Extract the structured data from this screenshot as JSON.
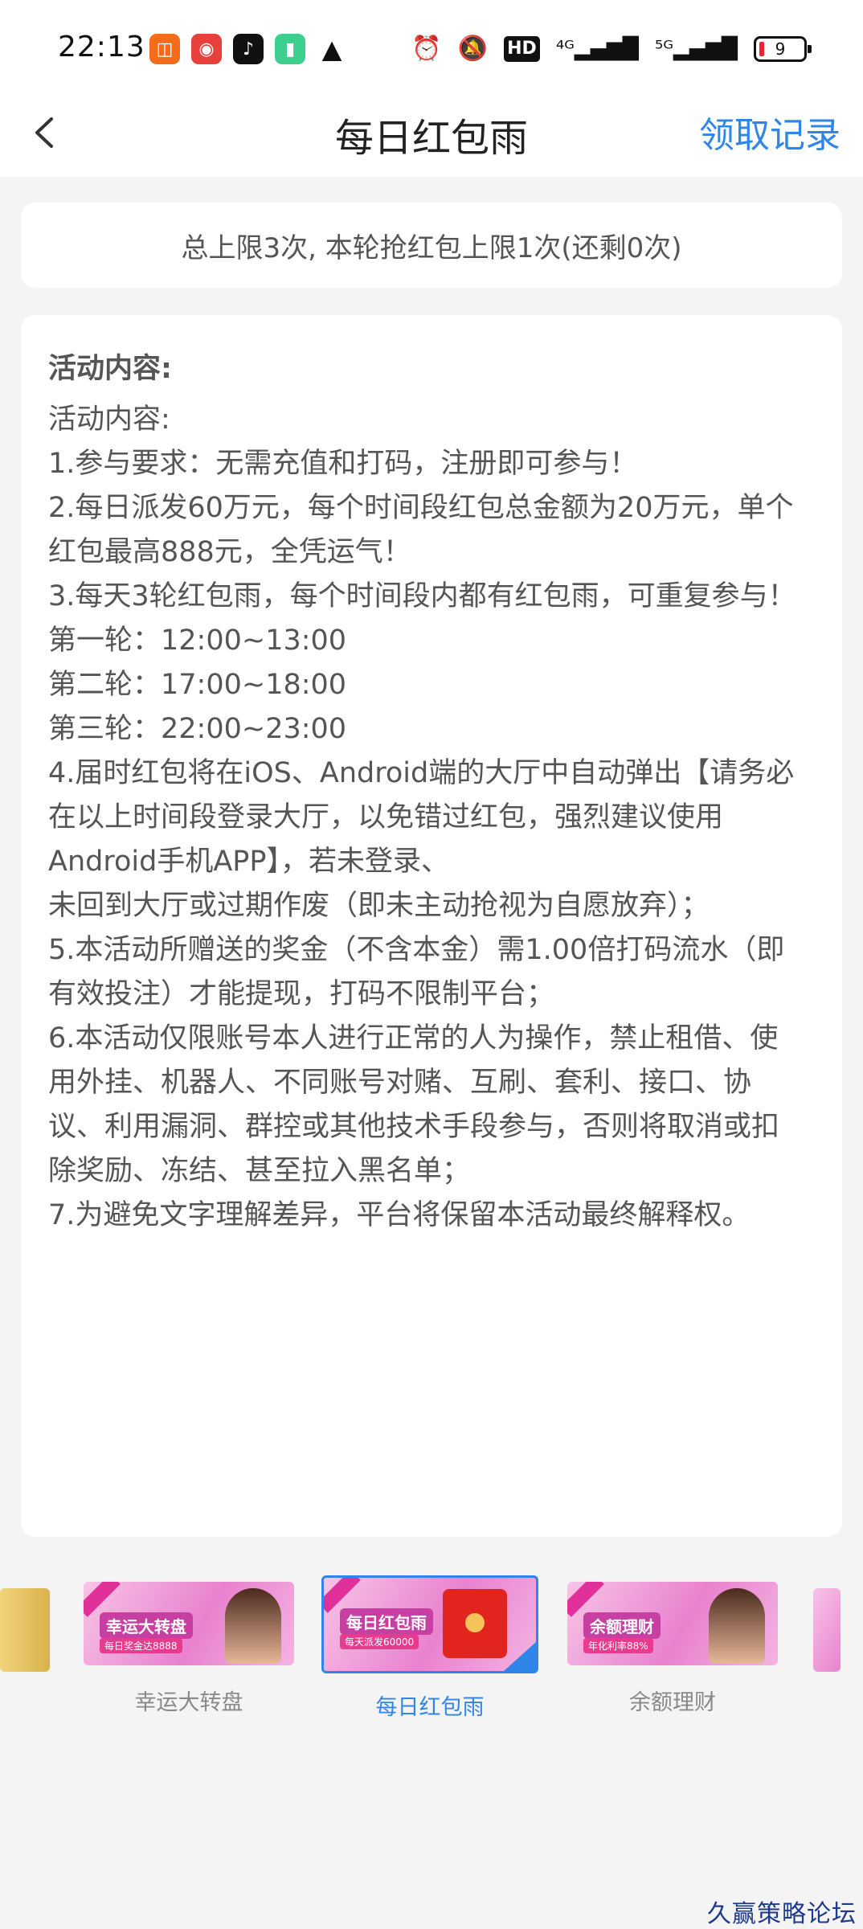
{
  "status_bar": {
    "time": "22:13",
    "right_icons": [
      "alarm-icon",
      "mute-icon",
      "hd-icon",
      "signal-4g-icon",
      "signal-5g-icon"
    ],
    "hd_label": "HD",
    "battery_level": "9"
  },
  "header": {
    "title": "每日红包雨",
    "right_link": "领取记录"
  },
  "limit_text": "总上限3次, 本轮抢红包上限1次(还剩0次)",
  "content": {
    "heading": "活动内容:",
    "lines": [
      "活动内容:",
      "1.参与要求：无需充值和打码，注册即可参与！",
      "2.每日派发60万元，每个时间段红包总金额为20万元，单个",
      "红包最高888元，全凭运气！",
      "3.每天3轮红包雨，每个时间段内都有红包雨，可重复参与！",
      "第一轮：12:00~13:00",
      "第二轮：17:00~18:00",
      "第三轮：22:00~23:00",
      "4.届时红包将在iOS、Android端的大厅中自动弹出【请务必",
      "在以上时间段登录大厅，以免错过红包，强烈建议使用",
      "Android手机APP】，若未登录、",
      "未回到大厅或过期作废（即未主动抢视为自愿放弃）；",
      "5.本活动所赠送的奖金（不含本金）需1.00倍打码流水（即",
      "有效投注）才能提现，打码不限制平台；",
      "6.本活动仅限账号本人进行正常的人为操作，禁止租借、使",
      "用外挂、机器人、不同账号对赌、互刷、套利、接口、协",
      "议、利用漏洞、群控或其他技术手段参与，否则将取消或扣",
      "除奖励、冻结、甚至拉入黑名单；",
      "7.为避免文字理解差异，平台将保留本活动最终解释权。"
    ]
  },
  "tabs": [
    {
      "label": "幸运大转盘",
      "banner_title": "幸运大转盘",
      "banner_sub": "每日奖金达8888",
      "active": false
    },
    {
      "label": "每日红包雨",
      "banner_title": "每日红包雨",
      "banner_sub": "每天派发60000",
      "active": true
    },
    {
      "label": "余额理财",
      "banner_title": "余额理财",
      "banner_sub": "年化利率88%",
      "active": false
    }
  ],
  "watermark": "久赢策略论坛"
}
